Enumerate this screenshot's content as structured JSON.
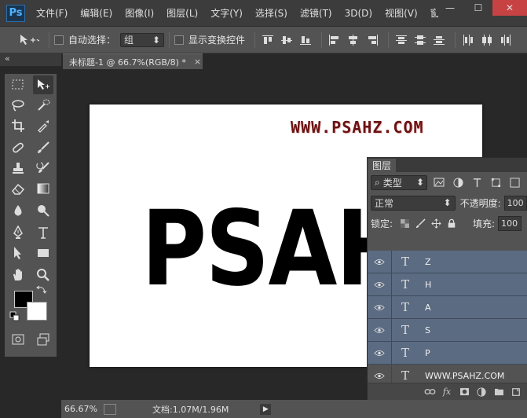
{
  "app": {
    "logo": "Ps",
    "menu": [
      "文件(F)",
      "编辑(E)",
      "图像(I)",
      "图层(L)",
      "文字(Y)",
      "选择(S)",
      "滤镜(T)",
      "3D(D)",
      "视图(V)",
      "窗"
    ],
    "window_controls": {
      "minimize": "—",
      "maximize": "☐",
      "close": "✕"
    }
  },
  "options_bar": {
    "auto_select_label": "自动选择：",
    "auto_select_value": "组",
    "show_transform_label": "显示变换控件"
  },
  "toolbar": {
    "collapse_glyph": "«"
  },
  "document": {
    "tab_title": "未标题-1 @ 66.7%(RGB/8) *",
    "tab_close": "×",
    "watermark": "WWW.PSAHZ.COM",
    "main_text": "PSAHZ"
  },
  "status_bar": {
    "zoom": "66.67%",
    "doc_info": "文档:1.07M/1.96M",
    "arrow": "▶"
  },
  "layers_panel": {
    "tab": "图层",
    "filter_label": "类型",
    "blend_mode": "正常",
    "opacity_label": "不透明度:",
    "opacity_value": "100",
    "lock_label": "锁定:",
    "fill_label": "填充:",
    "fill_value": "100",
    "layers": [
      {
        "name": "Z",
        "type": "T",
        "selected": true
      },
      {
        "name": "H",
        "type": "T",
        "selected": true
      },
      {
        "name": "A",
        "type": "T",
        "selected": true
      },
      {
        "name": "S",
        "type": "T",
        "selected": true
      },
      {
        "name": "P",
        "type": "T",
        "selected": true
      },
      {
        "name": "WWW.PSAHZ.COM",
        "type": "T",
        "selected": false
      }
    ],
    "bottom_icons": [
      "link-icon",
      "fx-icon",
      "mask-icon",
      "adjustment-icon",
      "folder-icon",
      "new-layer-icon"
    ]
  }
}
